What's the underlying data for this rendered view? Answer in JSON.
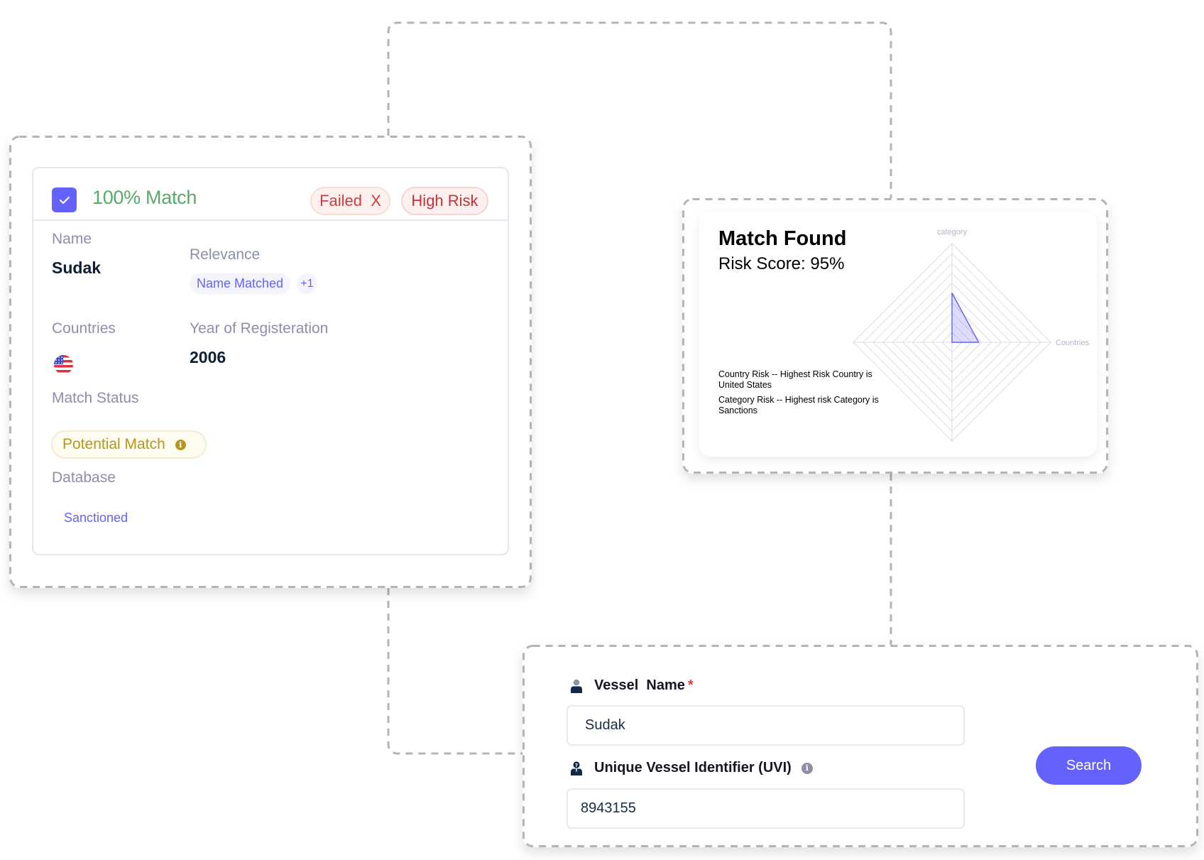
{
  "result_card": {
    "checked": true,
    "match_percent_label": "100% Match",
    "badges": {
      "failed": "Failed  X",
      "risk": "High Risk"
    },
    "fields": {
      "name_label": "Name",
      "name_value": "Sudak",
      "relevance_label": "Relevance",
      "relevance_tags": [
        "Name Matched",
        "+1"
      ],
      "countries_label": "Countries",
      "country_flag": "us-flag-icon",
      "year_label": "Year of Registeration",
      "year_value": "2006",
      "match_status_label": "Match Status",
      "match_status_value": "Potential Match",
      "match_status_icon": "i",
      "database_label": "Database",
      "database_value": "Sanctioned"
    }
  },
  "risk_card": {
    "title": "Match Found",
    "risk_score_label": "Risk Score:",
    "risk_score_value": "95%",
    "notes": [
      "Country Risk -- Highest Risk Country is United States",
      "Category Risk -- Highest risk Category is Sanctions"
    ]
  },
  "chart_data": {
    "type": "radar",
    "title": "",
    "axes": [
      "category",
      "Countries",
      "",
      ""
    ],
    "values": [
      0.5,
      0.27,
      0,
      0
    ],
    "range": [
      0,
      1
    ],
    "rings": 10,
    "series_color": "#6461fc",
    "grid": true
  },
  "search_form": {
    "vessel_name_label": "Vessel  Name",
    "vessel_name_required": "*",
    "vessel_name_value": "Sudak",
    "uvi_label": "Unique Vessel Identifier (UVI)",
    "uvi_info_icon": "i",
    "uvi_value": "8943155",
    "search_button": "Search"
  },
  "colors": {
    "accent": "#6461fc",
    "success": "#58a96b",
    "danger": "#d23b3b",
    "warning": "#b3981d",
    "dash": "#b4b4b4"
  }
}
